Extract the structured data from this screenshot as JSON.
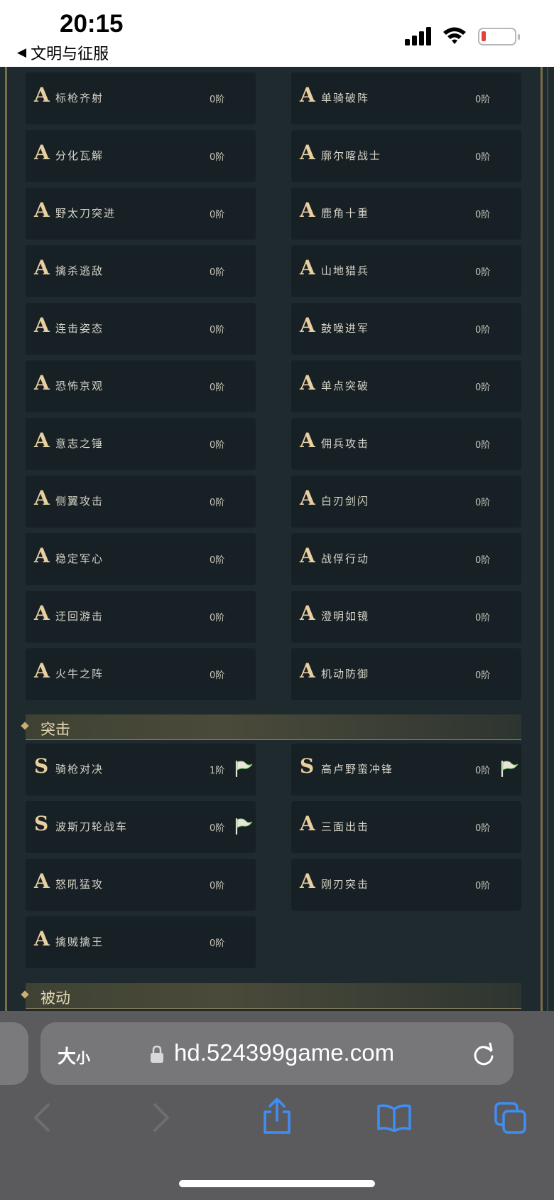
{
  "status": {
    "time": "20:15",
    "back_app": "文明与征服"
  },
  "section_top": {
    "left": [
      {
        "grade": "A",
        "name": "标枪齐射",
        "level": "0阶"
      },
      {
        "grade": "A",
        "name": "分化瓦解",
        "level": "0阶"
      },
      {
        "grade": "A",
        "name": "野太刀突进",
        "level": "0阶"
      },
      {
        "grade": "A",
        "name": "擒杀逃敌",
        "level": "0阶"
      },
      {
        "grade": "A",
        "name": "连击姿态",
        "level": "0阶"
      },
      {
        "grade": "A",
        "name": "恐怖京观",
        "level": "0阶"
      },
      {
        "grade": "A",
        "name": "意志之锤",
        "level": "0阶"
      },
      {
        "grade": "A",
        "name": "侧翼攻击",
        "level": "0阶"
      },
      {
        "grade": "A",
        "name": "稳定军心",
        "level": "0阶"
      },
      {
        "grade": "A",
        "name": "迂回游击",
        "level": "0阶"
      },
      {
        "grade": "A",
        "name": "火牛之阵",
        "level": "0阶"
      }
    ],
    "right": [
      {
        "grade": "A",
        "name": "单骑破阵",
        "level": "0阶"
      },
      {
        "grade": "A",
        "name": "廓尔喀战士",
        "level": "0阶"
      },
      {
        "grade": "A",
        "name": "鹿角十重",
        "level": "0阶"
      },
      {
        "grade": "A",
        "name": "山地猎兵",
        "level": "0阶"
      },
      {
        "grade": "A",
        "name": "鼓噪进军",
        "level": "0阶"
      },
      {
        "grade": "A",
        "name": "单点突破",
        "level": "0阶"
      },
      {
        "grade": "A",
        "name": "佣兵攻击",
        "level": "0阶"
      },
      {
        "grade": "A",
        "name": "白刃剑闪",
        "level": "0阶"
      },
      {
        "grade": "A",
        "name": "战俘行动",
        "level": "0阶"
      },
      {
        "grade": "A",
        "name": "澄明如镜",
        "level": "0阶"
      },
      {
        "grade": "A",
        "name": "机动防御",
        "level": "0阶"
      }
    ]
  },
  "section_assault": {
    "title": "突击",
    "items": [
      {
        "grade": "S",
        "name": "骑枪对决",
        "level": "1阶",
        "flag": "flag-icon"
      },
      {
        "grade": "S",
        "name": "高卢野蛮冲锋",
        "level": "0阶",
        "flag": "flag-icon"
      },
      {
        "grade": "S",
        "name": "波斯刀轮战车",
        "level": "0阶",
        "flag": "flag-icon"
      },
      {
        "grade": "A",
        "name": "三面出击",
        "level": "0阶"
      },
      {
        "grade": "A",
        "name": "怒吼猛攻",
        "level": "0阶"
      },
      {
        "grade": "A",
        "name": "刚刃突击",
        "level": "0阶"
      },
      {
        "grade": "A",
        "name": "擒贼擒王",
        "level": "0阶"
      }
    ]
  },
  "section_passive": {
    "title": "被动"
  },
  "browser": {
    "text_size": "大",
    "text_size_small": "小",
    "url": "hd.524399game.com"
  },
  "colors": {
    "grade_gold": "#e7cfa0",
    "card_bg": "#172024",
    "page_bg": "#1f2a2e"
  }
}
